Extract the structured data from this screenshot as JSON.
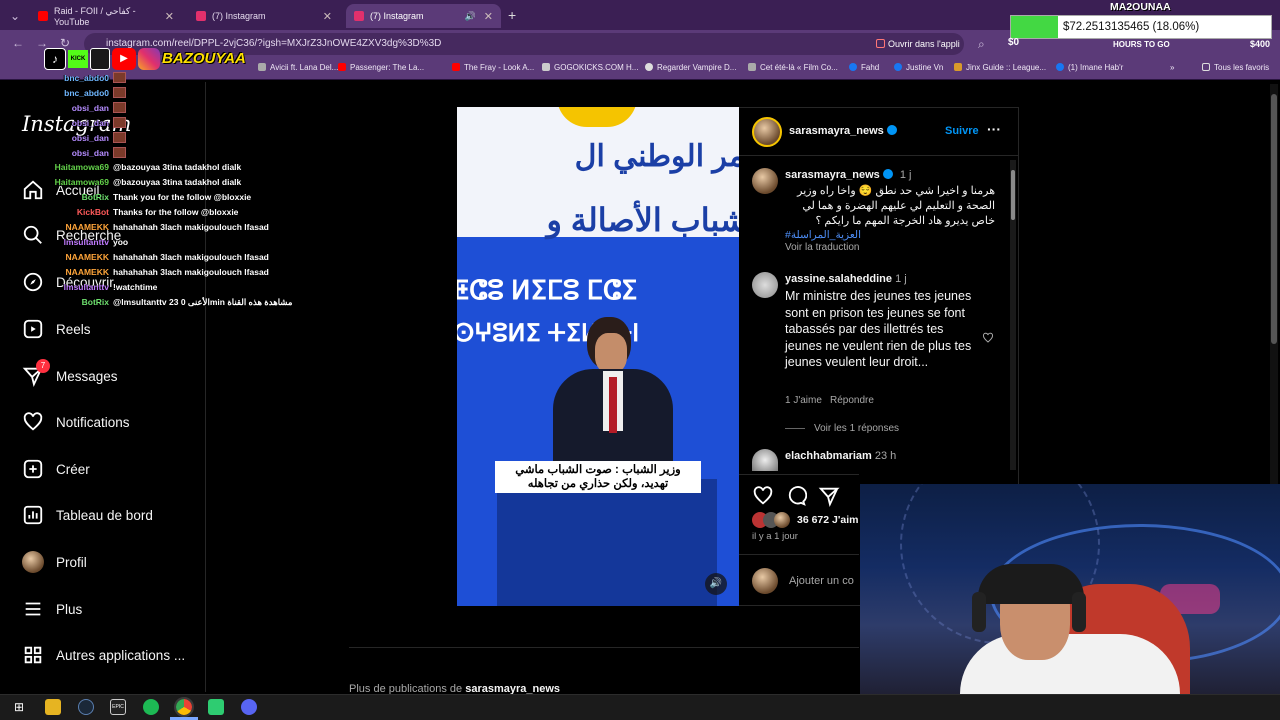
{
  "browser": {
    "tabs": [
      {
        "label": "Raid - FOII / كفاحي - YouTube",
        "color": "#ff0000"
      },
      {
        "label": "(7) Instagram",
        "color": "#e1306c"
      },
      {
        "label": "(7) Instagram",
        "color": "#e1306c"
      }
    ],
    "url": "instagram.com/reel/DPPL-2vjC36/?igsh=MXJrZ3JnOWE4ZXV3dg%3D%3D",
    "open_in_app": "Ouvrir dans l'appli",
    "bookmarks": [
      "Avicii ft. Lana Del...",
      "Passenger: The La...",
      "The Fray - Look A...",
      "GOGOKICKS.COM H...",
      "Regarder Vampire D...",
      "Cet été-là « Film Co...",
      "Fahd",
      "Justine Vn",
      "Jinx Guide :: League...",
      "(1) Imane Hab'r",
      "Tous les favoris"
    ]
  },
  "stream_overlay": {
    "channel": "BAZOUYAA",
    "streamer_name": "MA2OUNAA",
    "ticker": "$72.2513135465 (18.06%)",
    "hours_to_go": "HOURS TO GO",
    "dollar_zero": "$0",
    "dollar_400": "$400",
    "chat": [
      {
        "user": "bnc_abdo0",
        "msg": "",
        "color": "#6fb7ff",
        "emote": true
      },
      {
        "user": "bnc_abdo0",
        "msg": "",
        "color": "#6fb7ff",
        "emote": true
      },
      {
        "user": "obsi_dan",
        "msg": "",
        "color": "#b58cff",
        "emote": true
      },
      {
        "user": "obsi_dan",
        "msg": "",
        "color": "#b58cff",
        "emote": true
      },
      {
        "user": "obsi_dan",
        "msg": "",
        "color": "#b58cff",
        "emote": true
      },
      {
        "user": "obsi_dan",
        "msg": "",
        "color": "#b58cff",
        "emote": true
      },
      {
        "user": "Haitamowa69",
        "msg": "@bazouyaa 3tina tadakhol dialk",
        "color": "#63d24a"
      },
      {
        "user": "Haitamowa69",
        "msg": "@bazouyaa 3tina tadakhol dialk",
        "color": "#63d24a"
      },
      {
        "user": "BotRix",
        "msg": "Thank you for the follow @bloxxie",
        "color": "#6ee06e"
      },
      {
        "user": "KickBot",
        "msg": "Thanks for the follow @bloxxie",
        "color": "#ff5a5a"
      },
      {
        "user": "NAAMEKK",
        "msg": "hahahahah 3lach makigoulouch lfasad",
        "color": "#ffa53a"
      },
      {
        "user": "lmsultanttv",
        "msg": "yoo",
        "color": "#c07bff"
      },
      {
        "user": "NAAMEKK",
        "msg": "hahahahah 3lach makigoulouch lfasad",
        "color": "#ffa53a"
      },
      {
        "user": "NAAMEKK",
        "msg": "hahahahah 3lach makigoulouch lfasad",
        "color": "#ffa53a"
      },
      {
        "user": "lmsultanttv",
        "msg": "!watchtime",
        "color": "#c07bff"
      },
      {
        "user": "BotRix",
        "msg": "@lmsultanttv 23 الأعنى 0min مشاهدة هذه القناة",
        "color": "#6ee06e"
      }
    ]
  },
  "ig_nav": {
    "logo": "Instagram",
    "items": [
      "Accueil",
      "Recherche",
      "Découvrir",
      "Reels",
      "Messages",
      "Notifications",
      "Créer",
      "Tableau de bord",
      "Profil",
      "Plus",
      "Autres applications ..."
    ],
    "messages_badge": "7"
  },
  "post": {
    "author": "sarasmayra_news",
    "follow": "Suivre",
    "caption_time": "1 j",
    "caption": "هرمنا و اخيرا شي حد نطق 😌 واخا راه وزير الصحة و التعليم لي عليهم الهضرة و هما لي خاص يديرو هاد الخرجة المهم ما رايكم ؟",
    "hashtag": "#العزية_المراسلة",
    "translate": "Voir la traduction",
    "video_title_ar": "مر الوطني ال",
    "video_banner_ar": "شباب الأصالة و",
    "video_tifinagh1": "ⵟⵛⵓ ⵍⵉⵎⵓ ⵎⵛⵉ",
    "video_tifinagh2": "ⵙⵖⵓⵍⵉ ⵜⵉⵍⵎⵜⵏ",
    "subtitle_line1": "وزير الشباب : صوت الشباب ماشي",
    "subtitle_line2": "تهديد، ولكن حذاري من تجاهله",
    "comments": [
      {
        "user": "yassine.salaheddine",
        "time": "1 j",
        "text": "Mr ministre des jeunes tes jeunes sont en prison tes jeunes se font tabassés par des illettrés tes jeunes ne veulent rien de plus tes jeunes veulent leur droit...",
        "likes": "1 J'aime",
        "reply": "Répondre",
        "view_replies": "Voir les 1 réponses"
      },
      {
        "user": "elachhabmariam",
        "time": "23 h"
      }
    ],
    "like_count": "36 672 J'aim",
    "posted": "il y a 1 jour",
    "add_comment": "Ajouter un co",
    "more_from": "Plus de publications de",
    "more_from_user": "sarasmayra_news"
  }
}
